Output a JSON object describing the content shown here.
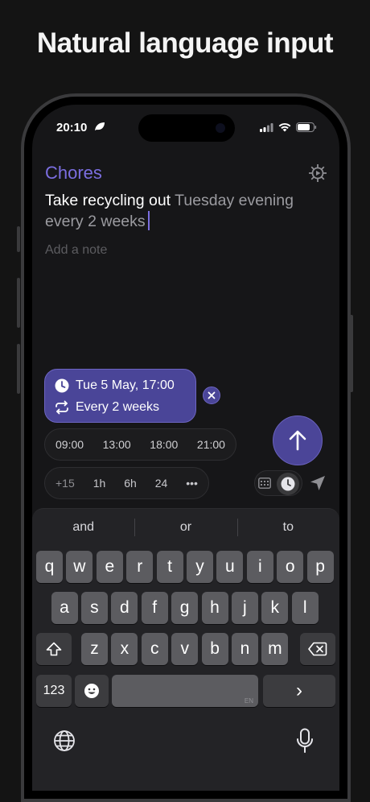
{
  "headline": "Natural language input",
  "status": {
    "time": "20:10"
  },
  "list_name": "Chores",
  "task": {
    "title": "Take recycling out",
    "parsed_date": "Tuesday evening",
    "parsed_repeat": "every 2 weeks",
    "note_placeholder": "Add a note"
  },
  "chip": {
    "date": "Tue 5 May, 17:00",
    "repeat": "Every 2 weeks"
  },
  "quick_times": [
    "09:00",
    "13:00",
    "18:00",
    "21:00"
  ],
  "offsets": [
    "+15",
    "1h",
    "6h",
    "24",
    "•••"
  ],
  "keyboard": {
    "suggestions": [
      "and",
      "or",
      "to"
    ],
    "row1": [
      "q",
      "w",
      "e",
      "r",
      "t",
      "y",
      "u",
      "i",
      "o",
      "p"
    ],
    "row2": [
      "a",
      "s",
      "d",
      "f",
      "g",
      "h",
      "j",
      "k",
      "l"
    ],
    "row3": [
      "z",
      "x",
      "c",
      "v",
      "b",
      "n",
      "m"
    ],
    "numbers_key": "123",
    "space_lang": "EN",
    "return_key": "›"
  },
  "colors": {
    "accent": "#7b6ee0",
    "chip_bg": "#4a4598",
    "screen_bg": "#161618",
    "key_bg": "#5c5c60"
  },
  "icons": [
    "leaf-icon",
    "signal-icon",
    "wifi-icon",
    "battery-icon",
    "settings-icon",
    "clock-icon",
    "repeat-icon",
    "close-icon",
    "arrow-up-icon",
    "calendar-icon",
    "location-arrow-icon",
    "shift-icon",
    "delete-icon",
    "emoji-icon",
    "globe-icon",
    "microphone-icon"
  ]
}
